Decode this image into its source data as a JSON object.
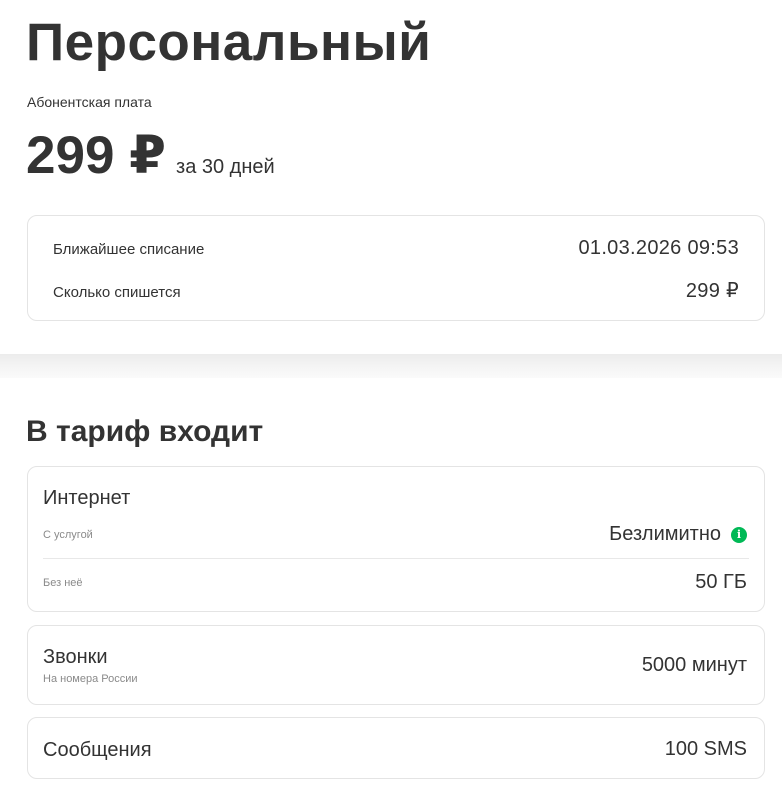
{
  "plan": {
    "title": "Персональный",
    "fee_label": "Абонентская плата",
    "price": "299 ₽",
    "period": "за 30 дней"
  },
  "billing": {
    "next_charge_label": "Ближайшее списание",
    "next_charge_value": "01.03.2026 09:53",
    "amount_label": "Сколько спишется",
    "amount_value": "299 ₽"
  },
  "included": {
    "title": "В тариф входит",
    "internet": {
      "title": "Интернет",
      "with_service_label": "С услугой",
      "with_service_value": "Безлимитно",
      "without_service_label": "Без неё",
      "without_service_value": "50 ГБ"
    },
    "calls": {
      "title": "Звонки",
      "subtitle": "На номера России",
      "value": "5000 минут"
    },
    "sms": {
      "title": "Сообщения",
      "value": "100 SMS"
    }
  },
  "colors": {
    "accent": "#00b956",
    "text": "#333333",
    "muted": "#8a8a8a",
    "border": "#e4e4e4"
  },
  "icons": {
    "info": "info-icon"
  }
}
